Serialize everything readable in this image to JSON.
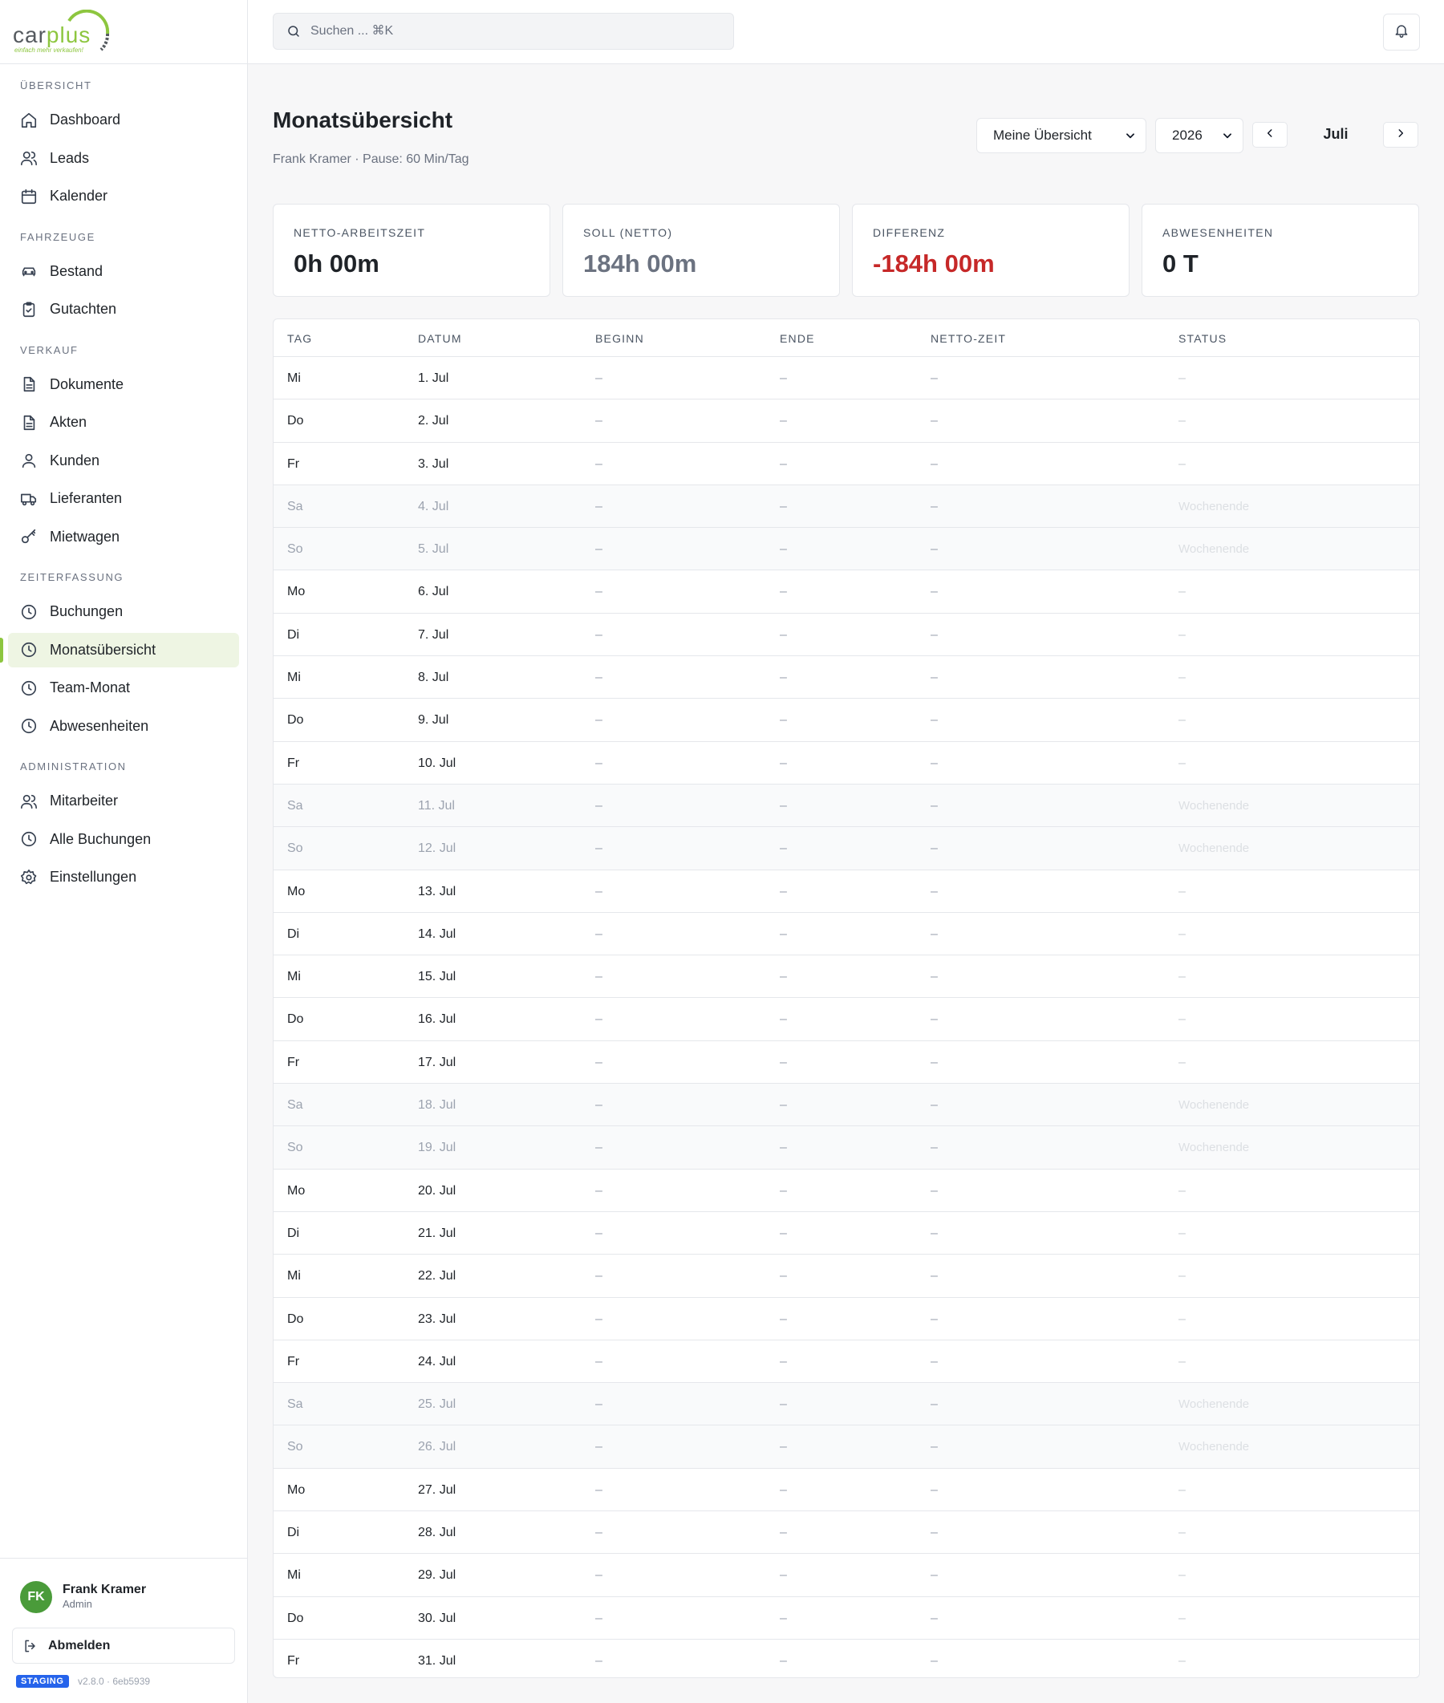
{
  "brand": {
    "logo_car": "car",
    "logo_plus": "plus",
    "logo_tagline": "einfach mehr verkaufen!",
    "accent": "#8dc63f"
  },
  "search": {
    "placeholder": "Suchen ... ⌘K",
    "value": ""
  },
  "sidebar": {
    "sections": [
      {
        "title": "ÜBERSICHT",
        "items": [
          {
            "label": "Dashboard",
            "icon": "home-icon"
          },
          {
            "label": "Leads",
            "icon": "users-icon"
          },
          {
            "label": "Kalender",
            "icon": "calendar-icon"
          }
        ]
      },
      {
        "title": "FAHRZEUGE",
        "items": [
          {
            "label": "Bestand",
            "icon": "car-icon"
          },
          {
            "label": "Gutachten",
            "icon": "clipboard-icon"
          }
        ]
      },
      {
        "title": "VERKAUF",
        "items": [
          {
            "label": "Dokumente",
            "icon": "document-icon"
          },
          {
            "label": "Akten",
            "icon": "document-icon"
          },
          {
            "label": "Kunden",
            "icon": "user-icon"
          },
          {
            "label": "Lieferanten",
            "icon": "truck-icon"
          },
          {
            "label": "Mietwagen",
            "icon": "key-icon"
          }
        ]
      },
      {
        "title": "ZEITERFASSUNG",
        "items": [
          {
            "label": "Buchungen",
            "icon": "clock-icon"
          },
          {
            "label": "Monatsübersicht",
            "icon": "clock-icon",
            "active": true
          },
          {
            "label": "Team-Monat",
            "icon": "clock-icon"
          },
          {
            "label": "Abwesenheiten",
            "icon": "clock-icon"
          }
        ]
      },
      {
        "title": "ADMINISTRATION",
        "items": [
          {
            "label": "Mitarbeiter",
            "icon": "users-icon"
          },
          {
            "label": "Alle Buchungen",
            "icon": "clock-icon"
          },
          {
            "label": "Einstellungen",
            "icon": "gear-icon"
          }
        ]
      }
    ]
  },
  "user": {
    "initials": "FK",
    "name": "Frank Kramer",
    "role": "Admin",
    "logout_label": "Abmelden",
    "env_badge": "STAGING",
    "version": "v2.8.0 · 6eb5939"
  },
  "header": {
    "title": "Monatsübersicht",
    "subtitle": "Frank Kramer · Pause: 60 Min/Tag",
    "view_select": "Meine Übersicht",
    "year_select": "2026",
    "month": "Juli"
  },
  "stats": [
    {
      "label": "NETTO-ARBEITSZEIT",
      "value": "0h 00m",
      "tone": "normal"
    },
    {
      "label": "SOLL (NETTO)",
      "value": "184h 00m",
      "tone": "muted"
    },
    {
      "label": "DIFFERENZ",
      "value": "-184h 00m",
      "tone": "negative",
      "color": "#c62828"
    },
    {
      "label": "ABWESENHEITEN",
      "value": "0 T",
      "tone": "normal"
    }
  ],
  "table": {
    "columns": [
      "TAG",
      "DATUM",
      "BEGINN",
      "ENDE",
      "NETTO-ZEIT",
      "STATUS"
    ],
    "rows": [
      {
        "tag": "Mi",
        "datum": "1. Jul",
        "beginn": "–",
        "ende": "–",
        "netto": "–",
        "status": "–"
      },
      {
        "tag": "Do",
        "datum": "2. Jul",
        "beginn": "–",
        "ende": "–",
        "netto": "–",
        "status": "–"
      },
      {
        "tag": "Fr",
        "datum": "3. Jul",
        "beginn": "–",
        "ende": "–",
        "netto": "–",
        "status": "–"
      },
      {
        "tag": "Sa",
        "datum": "4. Jul",
        "beginn": "–",
        "ende": "–",
        "netto": "–",
        "status": "Wochenende",
        "weekend": true
      },
      {
        "tag": "So",
        "datum": "5. Jul",
        "beginn": "–",
        "ende": "–",
        "netto": "–",
        "status": "Wochenende",
        "weekend": true
      },
      {
        "tag": "Mo",
        "datum": "6. Jul",
        "beginn": "–",
        "ende": "–",
        "netto": "–",
        "status": "–"
      },
      {
        "tag": "Di",
        "datum": "7. Jul",
        "beginn": "–",
        "ende": "–",
        "netto": "–",
        "status": "–"
      },
      {
        "tag": "Mi",
        "datum": "8. Jul",
        "beginn": "–",
        "ende": "–",
        "netto": "–",
        "status": "–"
      },
      {
        "tag": "Do",
        "datum": "9. Jul",
        "beginn": "–",
        "ende": "–",
        "netto": "–",
        "status": "–"
      },
      {
        "tag": "Fr",
        "datum": "10. Jul",
        "beginn": "–",
        "ende": "–",
        "netto": "–",
        "status": "–"
      },
      {
        "tag": "Sa",
        "datum": "11. Jul",
        "beginn": "–",
        "ende": "–",
        "netto": "–",
        "status": "Wochenende",
        "weekend": true
      },
      {
        "tag": "So",
        "datum": "12. Jul",
        "beginn": "–",
        "ende": "–",
        "netto": "–",
        "status": "Wochenende",
        "weekend": true
      },
      {
        "tag": "Mo",
        "datum": "13. Jul",
        "beginn": "–",
        "ende": "–",
        "netto": "–",
        "status": "–"
      },
      {
        "tag": "Di",
        "datum": "14. Jul",
        "beginn": "–",
        "ende": "–",
        "netto": "–",
        "status": "–"
      },
      {
        "tag": "Mi",
        "datum": "15. Jul",
        "beginn": "–",
        "ende": "–",
        "netto": "–",
        "status": "–"
      },
      {
        "tag": "Do",
        "datum": "16. Jul",
        "beginn": "–",
        "ende": "–",
        "netto": "–",
        "status": "–"
      },
      {
        "tag": "Fr",
        "datum": "17. Jul",
        "beginn": "–",
        "ende": "–",
        "netto": "–",
        "status": "–"
      },
      {
        "tag": "Sa",
        "datum": "18. Jul",
        "beginn": "–",
        "ende": "–",
        "netto": "–",
        "status": "Wochenende",
        "weekend": true
      },
      {
        "tag": "So",
        "datum": "19. Jul",
        "beginn": "–",
        "ende": "–",
        "netto": "–",
        "status": "Wochenende",
        "weekend": true
      },
      {
        "tag": "Mo",
        "datum": "20. Jul",
        "beginn": "–",
        "ende": "–",
        "netto": "–",
        "status": "–"
      },
      {
        "tag": "Di",
        "datum": "21. Jul",
        "beginn": "–",
        "ende": "–",
        "netto": "–",
        "status": "–"
      },
      {
        "tag": "Mi",
        "datum": "22. Jul",
        "beginn": "–",
        "ende": "–",
        "netto": "–",
        "status": "–"
      },
      {
        "tag": "Do",
        "datum": "23. Jul",
        "beginn": "–",
        "ende": "–",
        "netto": "–",
        "status": "–"
      },
      {
        "tag": "Fr",
        "datum": "24. Jul",
        "beginn": "–",
        "ende": "–",
        "netto": "–",
        "status": "–"
      },
      {
        "tag": "Sa",
        "datum": "25. Jul",
        "beginn": "–",
        "ende": "–",
        "netto": "–",
        "status": "Wochenende",
        "weekend": true
      },
      {
        "tag": "So",
        "datum": "26. Jul",
        "beginn": "–",
        "ende": "–",
        "netto": "–",
        "status": "Wochenende",
        "weekend": true
      },
      {
        "tag": "Mo",
        "datum": "27. Jul",
        "beginn": "–",
        "ende": "–",
        "netto": "–",
        "status": "–"
      },
      {
        "tag": "Di",
        "datum": "28. Jul",
        "beginn": "–",
        "ende": "–",
        "netto": "–",
        "status": "–"
      },
      {
        "tag": "Mi",
        "datum": "29. Jul",
        "beginn": "–",
        "ende": "–",
        "netto": "–",
        "status": "–"
      },
      {
        "tag": "Do",
        "datum": "30. Jul",
        "beginn": "–",
        "ende": "–",
        "netto": "–",
        "status": "–"
      },
      {
        "tag": "Fr",
        "datum": "31. Jul",
        "beginn": "–",
        "ende": "–",
        "netto": "–",
        "status": "–"
      }
    ]
  }
}
